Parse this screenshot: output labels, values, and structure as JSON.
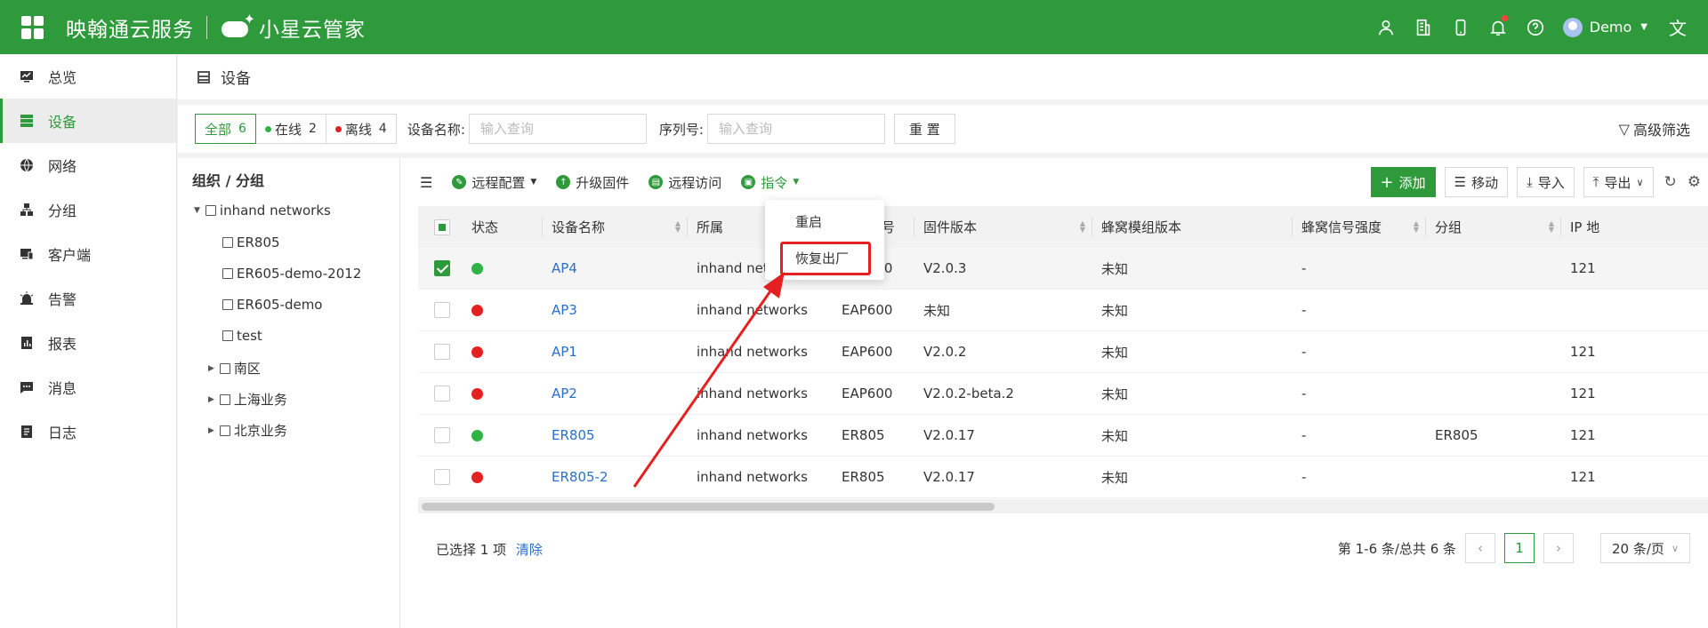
{
  "header": {
    "brand": "映翰通云服务",
    "product": "小星云管家",
    "user": "Demo"
  },
  "sidebar": {
    "items": [
      {
        "label": "总览",
        "icon": "overview-icon"
      },
      {
        "label": "设备",
        "icon": "device-icon"
      },
      {
        "label": "网络",
        "icon": "globe-icon"
      },
      {
        "label": "分组",
        "icon": "group-icon"
      },
      {
        "label": "客户端",
        "icon": "client-icon"
      },
      {
        "label": "告警",
        "icon": "alarm-icon"
      },
      {
        "label": "报表",
        "icon": "report-icon"
      },
      {
        "label": "消息",
        "icon": "message-icon"
      },
      {
        "label": "日志",
        "icon": "log-icon"
      }
    ]
  },
  "page": {
    "title": "设备"
  },
  "filter": {
    "all_label": "全部",
    "all_count": "6",
    "online_label": "在线",
    "online_count": "2",
    "offline_label": "离线",
    "offline_count": "4",
    "name_label": "设备名称:",
    "name_placeholder": "输入查询",
    "sn_label": "序列号:",
    "sn_placeholder": "输入查询",
    "reset_label": "重 置",
    "advanced_label": "高级筛选"
  },
  "tree": {
    "title": "组织 / 分组",
    "root": "inhand networks",
    "children": [
      "ER805",
      "ER605-demo-2012",
      "ER605-demo",
      "test"
    ],
    "groups": [
      "南区",
      "上海业务",
      "北京业务"
    ]
  },
  "toolbar": {
    "remote_config": "远程配置",
    "upgrade": "升级固件",
    "remote_access": "远程访问",
    "command": "指令",
    "add": "添加",
    "move": "移动",
    "import": "导入",
    "export": "导出"
  },
  "dropdown": {
    "items": [
      "重启",
      "恢复出厂"
    ]
  },
  "table": {
    "columns": [
      "状态",
      "设备名称",
      "所属",
      "产品型号",
      "固件版本",
      "蜂窝模组版本",
      "蜂窝信号强度",
      "分组",
      "IP 地"
    ],
    "rows": [
      {
        "status": "online",
        "name": "AP4",
        "org": "inhand networks",
        "model": "EAP600",
        "fw": "V2.0.3",
        "modem": "未知",
        "signal": "-",
        "group": "",
        "ip": "121",
        "selected": true
      },
      {
        "status": "offline",
        "name": "AP3",
        "org": "inhand networks",
        "model": "EAP600",
        "fw": "未知",
        "modem": "未知",
        "signal": "-",
        "group": "",
        "ip": "",
        "selected": false
      },
      {
        "status": "offline",
        "name": "AP1",
        "org": "inhand networks",
        "model": "EAP600",
        "fw": "V2.0.2",
        "modem": "未知",
        "signal": "-",
        "group": "",
        "ip": "121",
        "selected": false
      },
      {
        "status": "offline",
        "name": "AP2",
        "org": "inhand networks",
        "model": "EAP600",
        "fw": "V2.0.2-beta.2",
        "modem": "未知",
        "signal": "-",
        "group": "",
        "ip": "121",
        "selected": false
      },
      {
        "status": "online",
        "name": "ER805",
        "org": "inhand networks",
        "model": "ER805",
        "fw": "V2.0.17",
        "modem": "未知",
        "signal": "-",
        "group": "ER805",
        "ip": "121",
        "selected": false
      },
      {
        "status": "offline",
        "name": "ER805-2",
        "org": "inhand networks",
        "model": "ER805",
        "fw": "V2.0.17",
        "modem": "未知",
        "signal": "-",
        "group": "",
        "ip": "121",
        "selected": false
      }
    ]
  },
  "footer": {
    "selected_text": "已选择 1 项",
    "clear": "清除",
    "range": "第 1-6 条/总共 6 条",
    "page": "1",
    "page_size": "20 条/页"
  },
  "colors": {
    "brand_green": "#2e9a3b",
    "online": "#2fb344",
    "offline": "#e52020",
    "link": "#2a6fc9"
  }
}
